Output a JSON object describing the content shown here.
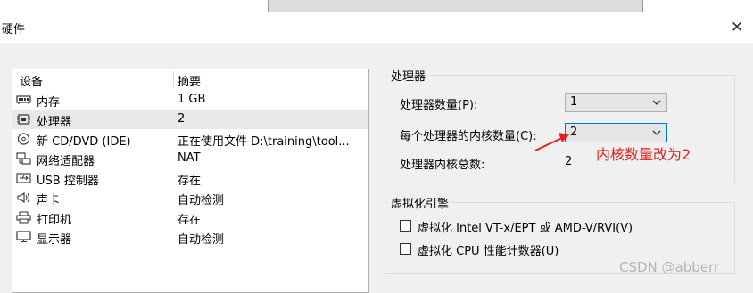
{
  "window": {
    "title": "硬件"
  },
  "devices": {
    "headers": {
      "device": "设备",
      "summary": "摘要"
    },
    "rows": [
      {
        "icon": "memory-icon",
        "name": "内存",
        "summary": "1 GB"
      },
      {
        "icon": "cpu-icon",
        "name": "处理器",
        "summary": "2",
        "selected": true
      },
      {
        "icon": "cd-dvd-icon",
        "name": "新 CD/DVD (IDE)",
        "summary": "正在使用文件 D:\\training\\tool..."
      },
      {
        "icon": "network-adapter-icon",
        "name": "网络适配器",
        "summary": "NAT"
      },
      {
        "icon": "usb-icon",
        "name": "USB 控制器",
        "summary": "存在"
      },
      {
        "icon": "speaker-icon",
        "name": "声卡",
        "summary": "自动检测"
      },
      {
        "icon": "printer-icon",
        "name": "打印机",
        "summary": "存在"
      },
      {
        "icon": "monitor-icon",
        "name": "显示器",
        "summary": "自动检测"
      }
    ]
  },
  "processor": {
    "group_title": "处理器",
    "count_label": "处理器数量(P):",
    "count_value": "1",
    "cores_label": "每个处理器的内核数量(C):",
    "cores_value": "2",
    "total_label": "处理器内核总数:",
    "total_value": "2"
  },
  "annotation": {
    "text": "内核数量改为2",
    "color": "#e02020"
  },
  "virtualization": {
    "group_title": "虚拟化引擎",
    "option1": "虚拟化 Intel VT-x/EPT 或 AMD-V/RVI(V)",
    "option2": "虚拟化 CPU 性能计数器(U)"
  },
  "watermark": "CSDN @abberr"
}
